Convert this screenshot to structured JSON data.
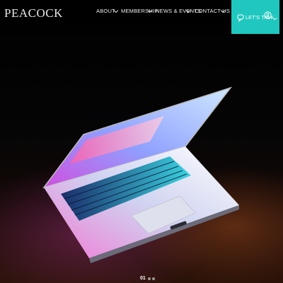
{
  "brand": {
    "logo_text": "PEACOCK"
  },
  "nav": {
    "items": [
      {
        "label": "ABOUT"
      },
      {
        "label": "MEMBERSHIP"
      },
      {
        "label": "NEWS & EVENTS"
      },
      {
        "label": "CONTACT US"
      }
    ]
  },
  "cta": {
    "label": "LET'S TALK",
    "color": "#1fc7bf"
  },
  "icons": {
    "chat": "chat-bubble-icon",
    "user": "user-circle-icon",
    "chevron": "chevron-down-icon"
  },
  "slider": {
    "current": "01"
  }
}
